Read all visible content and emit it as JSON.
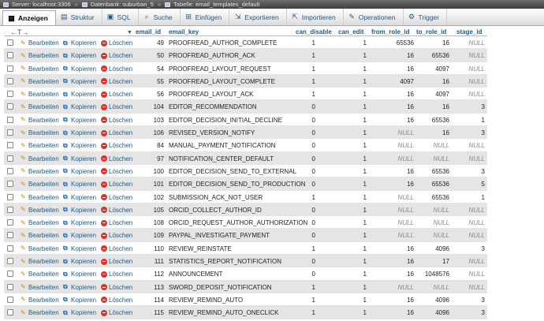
{
  "breadcrumb": [
    {
      "label": "Server: localhost:3306",
      "icon": "server-icon"
    },
    {
      "label": "Datenbank: suburban_5",
      "icon": "database-icon"
    },
    {
      "label": "Tabelle: email_templates_default",
      "icon": "table-icon"
    }
  ],
  "breadcrumb_sep": "»",
  "tabs": [
    {
      "label": "Anzeigen",
      "icon": "table-browse-icon",
      "glyph": "▦",
      "active": true
    },
    {
      "label": "Struktur",
      "icon": "structure-icon",
      "glyph": "▤",
      "active": false
    },
    {
      "label": "SQL",
      "icon": "sql-icon",
      "glyph": "▣",
      "active": false
    },
    {
      "label": "Suche",
      "icon": "search-icon",
      "glyph": "⌕",
      "active": false
    },
    {
      "label": "Einfügen",
      "icon": "insert-icon",
      "glyph": "⊞",
      "active": false
    },
    {
      "label": "Exportieren",
      "icon": "export-icon",
      "glyph": "⇲",
      "active": false
    },
    {
      "label": "Importieren",
      "icon": "import-icon",
      "glyph": "⇱",
      "active": false
    },
    {
      "label": "Operationen",
      "icon": "wrench-icon",
      "glyph": "✎",
      "active": false
    },
    {
      "label": "Trigger",
      "icon": "trigger-icon",
      "glyph": "⚙",
      "active": false
    }
  ],
  "header": {
    "arrows": "←T→",
    "email_id": "email_id",
    "email_key": "email_key",
    "can_disable": "can_disable",
    "can_edit": "can_edit",
    "from_role_id": "from_role_id",
    "to_role_id": "to_role_id",
    "stage_id": "stage_id"
  },
  "actions": {
    "edit": "Bearbeiten",
    "copy": "Kopieren",
    "delete": "Löschen"
  },
  "rows": [
    {
      "email_id": "49",
      "email_key": "PROOFREAD_AUTHOR_COMPLETE",
      "can_disable": "1",
      "can_edit": "1",
      "from_role_id": "65536",
      "to_role_id": "16",
      "stage_id": "NULL"
    },
    {
      "email_id": "50",
      "email_key": "PROOFREAD_AUTHOR_ACK",
      "can_disable": "1",
      "can_edit": "1",
      "from_role_id": "16",
      "to_role_id": "65536",
      "stage_id": "NULL"
    },
    {
      "email_id": "54",
      "email_key": "PROOFREAD_LAYOUT_REQUEST",
      "can_disable": "1",
      "can_edit": "1",
      "from_role_id": "16",
      "to_role_id": "4097",
      "stage_id": "NULL"
    },
    {
      "email_id": "55",
      "email_key": "PROOFREAD_LAYOUT_COMPLETE",
      "can_disable": "1",
      "can_edit": "1",
      "from_role_id": "4097",
      "to_role_id": "16",
      "stage_id": "NULL"
    },
    {
      "email_id": "56",
      "email_key": "PROOFREAD_LAYOUT_ACK",
      "can_disable": "1",
      "can_edit": "1",
      "from_role_id": "16",
      "to_role_id": "4097",
      "stage_id": "NULL"
    },
    {
      "email_id": "104",
      "email_key": "EDITOR_RECOMMENDATION",
      "can_disable": "0",
      "can_edit": "1",
      "from_role_id": "16",
      "to_role_id": "16",
      "stage_id": "3"
    },
    {
      "email_id": "103",
      "email_key": "EDITOR_DECISION_INITIAL_DECLINE",
      "can_disable": "0",
      "can_edit": "1",
      "from_role_id": "16",
      "to_role_id": "65536",
      "stage_id": "1"
    },
    {
      "email_id": "106",
      "email_key": "REVISED_VERSION_NOTIFY",
      "can_disable": "0",
      "can_edit": "1",
      "from_role_id": "NULL",
      "to_role_id": "16",
      "stage_id": "3"
    },
    {
      "email_id": "84",
      "email_key": "MANUAL_PAYMENT_NOTIFICATION",
      "can_disable": "0",
      "can_edit": "1",
      "from_role_id": "NULL",
      "to_role_id": "NULL",
      "stage_id": "NULL"
    },
    {
      "email_id": "97",
      "email_key": "NOTIFICATION_CENTER_DEFAULT",
      "can_disable": "0",
      "can_edit": "1",
      "from_role_id": "NULL",
      "to_role_id": "NULL",
      "stage_id": "NULL"
    },
    {
      "email_id": "100",
      "email_key": "EDITOR_DECISION_SEND_TO_EXTERNAL",
      "can_disable": "0",
      "can_edit": "1",
      "from_role_id": "16",
      "to_role_id": "65536",
      "stage_id": "3"
    },
    {
      "email_id": "101",
      "email_key": "EDITOR_DECISION_SEND_TO_PRODUCTION",
      "can_disable": "0",
      "can_edit": "1",
      "from_role_id": "16",
      "to_role_id": "65536",
      "stage_id": "5"
    },
    {
      "email_id": "102",
      "email_key": "SUBMISSION_ACK_NOT_USER",
      "can_disable": "1",
      "can_edit": "1",
      "from_role_id": "NULL",
      "to_role_id": "65536",
      "stage_id": "1"
    },
    {
      "email_id": "105",
      "email_key": "ORCID_COLLECT_AUTHOR_ID",
      "can_disable": "0",
      "can_edit": "1",
      "from_role_id": "NULL",
      "to_role_id": "NULL",
      "stage_id": "NULL"
    },
    {
      "email_id": "108",
      "email_key": "ORCID_REQUEST_AUTHOR_AUTHORIZATION",
      "can_disable": "0",
      "can_edit": "1",
      "from_role_id": "NULL",
      "to_role_id": "NULL",
      "stage_id": "NULL"
    },
    {
      "email_id": "109",
      "email_key": "PAYPAL_INVESTIGATE_PAYMENT",
      "can_disable": "0",
      "can_edit": "1",
      "from_role_id": "NULL",
      "to_role_id": "NULL",
      "stage_id": "NULL"
    },
    {
      "email_id": "110",
      "email_key": "REVIEW_REINSTATE",
      "can_disable": "1",
      "can_edit": "1",
      "from_role_id": "16",
      "to_role_id": "4096",
      "stage_id": "3"
    },
    {
      "email_id": "111",
      "email_key": "STATISTICS_REPORT_NOTIFICATION",
      "can_disable": "0",
      "can_edit": "1",
      "from_role_id": "16",
      "to_role_id": "17",
      "stage_id": "NULL"
    },
    {
      "email_id": "112",
      "email_key": "ANNOUNCEMENT",
      "can_disable": "0",
      "can_edit": "1",
      "from_role_id": "16",
      "to_role_id": "1048576",
      "stage_id": "NULL"
    },
    {
      "email_id": "113",
      "email_key": "SWORD_DEPOSIT_NOTIFICATION",
      "can_disable": "1",
      "can_edit": "1",
      "from_role_id": "NULL",
      "to_role_id": "NULL",
      "stage_id": "NULL"
    },
    {
      "email_id": "114",
      "email_key": "REVIEW_REMIND_AUTO",
      "can_disable": "1",
      "can_edit": "1",
      "from_role_id": "16",
      "to_role_id": "4096",
      "stage_id": "3"
    },
    {
      "email_id": "115",
      "email_key": "REVIEW_REMIND_AUTO_ONECLICK",
      "can_disable": "1",
      "can_edit": "1",
      "from_role_id": "16",
      "to_role_id": "4096",
      "stage_id": "3"
    }
  ]
}
